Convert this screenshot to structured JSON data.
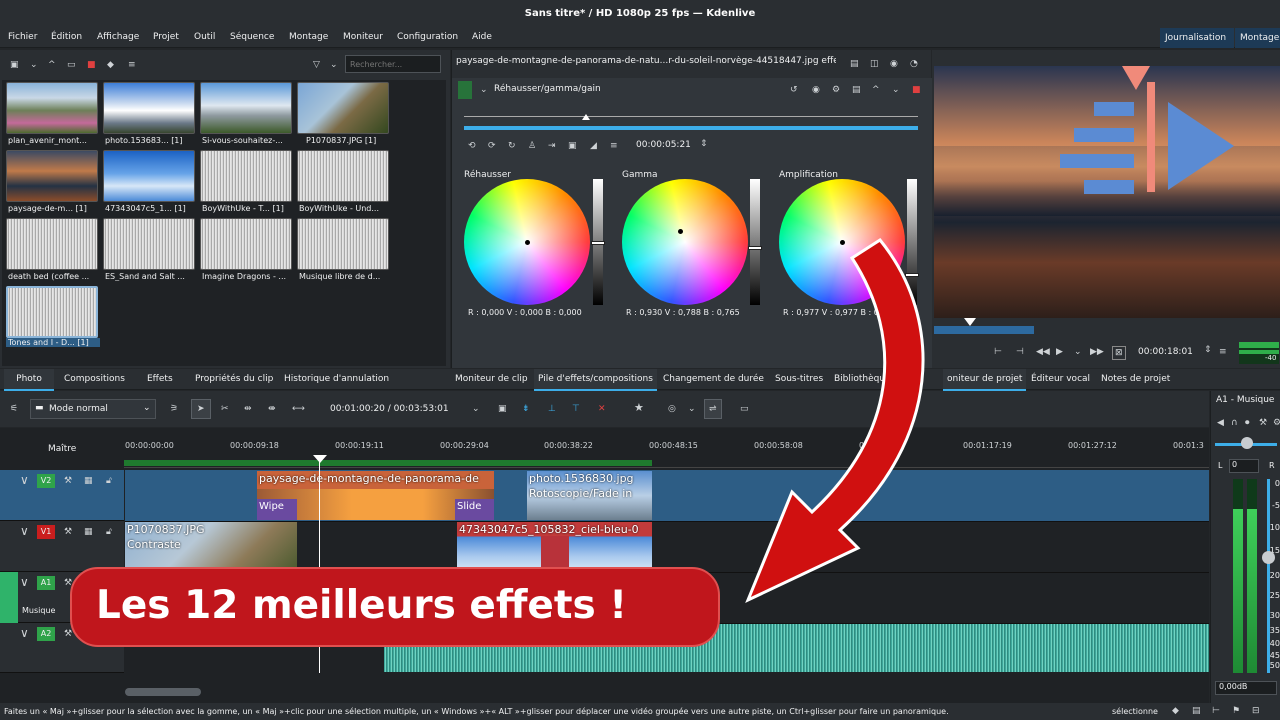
{
  "window": {
    "title": "Sans titre* / HD 1080p 25 fps — Kdenlive"
  },
  "menu": [
    "Fichier",
    "Édition",
    "Affichage",
    "Projet",
    "Outil",
    "Séquence",
    "Montage",
    "Moniteur",
    "Configuration",
    "Aide"
  ],
  "layouts": [
    "Journalisation",
    "Montage"
  ],
  "bin": {
    "search_placeholder": "Rechercher...",
    "items": [
      {
        "label": "plan_avenir_mont..."
      },
      {
        "label": "photo.153683... [1]"
      },
      {
        "label": "Si-vous-souhaitez-..."
      },
      {
        "label": "P1070837.JPG [1]"
      },
      {
        "label": "paysage-de-m... [1]"
      },
      {
        "label": "47343047c5_1... [1]"
      },
      {
        "label": "BoyWithUke - T... [1]"
      },
      {
        "label": "BoyWithUke - Und..."
      },
      {
        "label": "death bed (coffee ..."
      },
      {
        "label": "ES_Sand and Salt ..."
      },
      {
        "label": "Imagine Dragons - ..."
      },
      {
        "label": "Musique libre de d..."
      },
      {
        "label": "Tones and I - D... [1]"
      }
    ]
  },
  "effects": {
    "header": "paysage-de-montagne-de-panorama-de-natu...r-du-soleil-norvège-44518447.jpg effets",
    "effect_name": "Réhausser/gamma/gain",
    "timecode": "00:00:05:21",
    "wheels": [
      {
        "label": "Réhausser",
        "rgb": "R : 0,000   V : 0,000   B : 0,000"
      },
      {
        "label": "Gamma",
        "rgb": "R : 0,930   V : 0,788   B : 0,765"
      },
      {
        "label": "Amplification",
        "rgb": "R : 0,977   V : 0,977   B : 0,9"
      }
    ]
  },
  "monitor": {
    "timecode": "00:00:18:01",
    "level": "-40"
  },
  "tabs_left": [
    "Photo",
    "Compositions",
    "Effets",
    "Propriétés du clip",
    "Historique d'annulation"
  ],
  "tabs_mid": [
    "Moniteur de clip",
    "Pile d'effets/compositions",
    "Changement de durée",
    "Sous-titres",
    "Bibliothèque"
  ],
  "tabs_right": [
    "oniteur de projet",
    "Éditeur vocal",
    "Notes de projet"
  ],
  "timeline": {
    "mode": "Mode normal",
    "position": "00:01:00:20 / 00:03:53:01",
    "master_label": "Maître",
    "ruler": [
      "00:00:00:00",
      "00:00:09:18",
      "00:00:19:11",
      "00:00:29:04",
      "00:00:38:22",
      "00:00:48:15",
      "00:00:58:08",
      "00:01",
      "00:01:17:19",
      "00:01:27:12",
      "00:01:3"
    ],
    "tracks": [
      {
        "badge": "V2"
      },
      {
        "badge": "V1"
      },
      {
        "badge": "A1",
        "name": "Musique"
      },
      {
        "badge": "A2"
      }
    ],
    "clips": {
      "v2a_name": "paysage-de-montagne-de-panorama-de",
      "v2a_wipe": "Wipe",
      "v2a_slide": "Slide",
      "v2b_name": "photo.1536830.jpg",
      "v2b_effect": "Rotoscopie/Fade in",
      "v1a_name": "P1070837.JPG",
      "v1a_effect": "Contraste",
      "v1b_name": "47343047c5_105832_ciel-bleu-0"
    }
  },
  "mixer": {
    "title": "A1 - Musique",
    "l": "L",
    "r": "R",
    "pan": "0",
    "scale": [
      "0",
      "-5",
      "-10",
      "-15",
      "-20",
      "-25",
      "-30",
      "-35",
      "-40",
      "-45",
      "-50"
    ],
    "db": "0,00dB"
  },
  "overlay": {
    "text": "Les 12 meilleurs effets !"
  },
  "status": {
    "hint": "Faites un « Maj »+glisser pour la sélection avec la gomme, un « Maj »+clic pour une sélection multiple, un « Windows »+« ALT »+glisser pour déplacer une vidéo groupée vers une autre piste, un Ctrl+glisser pour faire un panoramique.",
    "selection": "sélectionne"
  },
  "colors": {
    "accent": "#3daee9",
    "overlay_red": "#c0161c",
    "arrow_red": "#d01010"
  }
}
